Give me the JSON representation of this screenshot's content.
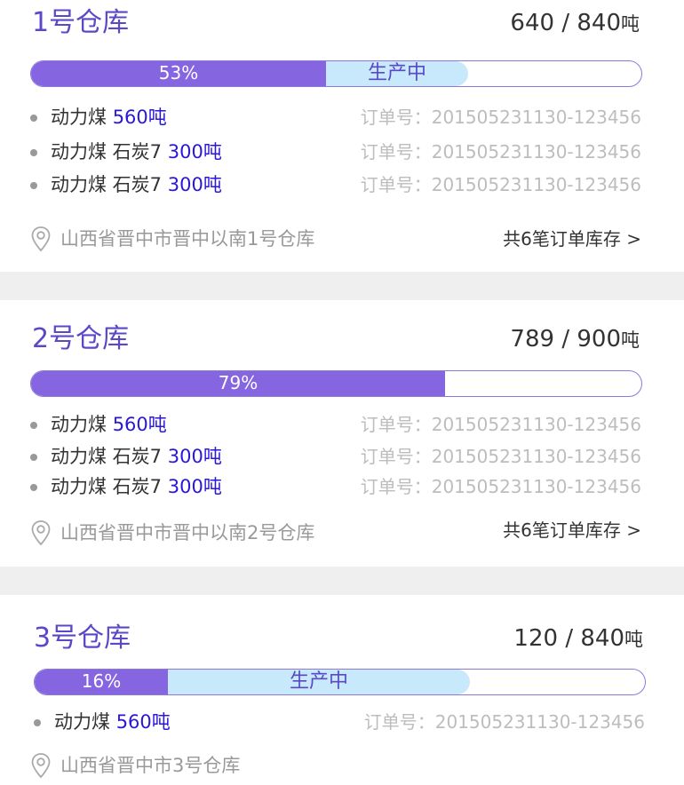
{
  "warehouses": [
    {
      "name": "1号仓库",
      "current": "640",
      "capacity": "840",
      "unit": "吨",
      "percent_label": "53%",
      "percent": 53,
      "status": "生产中",
      "items": [
        {
          "product": "动力煤",
          "qty": "560吨",
          "order": "订单号：201505231130-123456"
        },
        {
          "product": "动力煤 石炭7",
          "qty": "300吨",
          "order": "订单号：201505231130-123456"
        },
        {
          "product": "动力煤 石炭7",
          "qty": "300吨",
          "order": "订单号：201505231130-123456"
        }
      ],
      "address": "山西省晋中市晋中以南1号仓库",
      "more": "共6笔订单库存 >"
    },
    {
      "name": "2号仓库",
      "current": "789",
      "capacity": "900",
      "unit": "吨",
      "percent_label": "79%",
      "percent": 79,
      "items": [
        {
          "product": "动力煤",
          "qty": "560吨",
          "order": "订单号：201505231130-123456"
        },
        {
          "product": "动力煤 石炭7",
          "qty": "300吨",
          "order": "订单号：201505231130-123456"
        },
        {
          "product": "动力煤 石炭7",
          "qty": "300吨",
          "order": "订单号：201505231130-123456"
        }
      ],
      "address": "山西省晋中市晋中以南2号仓库",
      "more": "共6笔订单库存 >"
    },
    {
      "name": "3号仓库",
      "current": "120",
      "capacity": "840",
      "unit": "吨",
      "percent_label": "16%",
      "percent": 16,
      "status": "生产中",
      "items": [
        {
          "product": "动力煤",
          "qty": "560吨",
          "order": "订单号：201505231130-123456"
        }
      ],
      "address": "山西省晋中市3号仓库"
    }
  ]
}
